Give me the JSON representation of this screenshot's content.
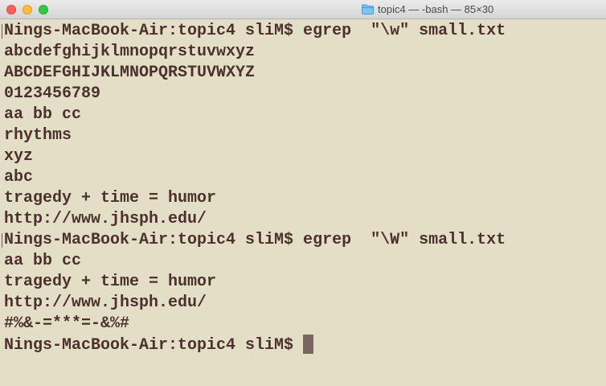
{
  "window": {
    "title": "topic4 — -bash — 85×30",
    "title_icon": "folder-icon",
    "controls": [
      "close-button",
      "minimize-button",
      "zoom-button"
    ],
    "colors": {
      "background": "#e3dfc7",
      "text": "#4b302c",
      "cursor": "#7b655e"
    }
  },
  "terminal": {
    "lines": [
      "Nings-MacBook-Air:topic4 sliM$ egrep  \"\\w\" small.txt",
      "abcdefghijklmnopqrstuvwxyz",
      "ABCDEFGHIJKLMNOPQRSTUVWXYZ",
      "0123456789",
      "aa bb cc",
      "rhythms",
      "xyz",
      "abc",
      "tragedy + time = humor",
      "http://www.jhsph.edu/",
      "Nings-MacBook-Air:topic4 sliM$ egrep  \"\\W\" small.txt",
      "aa bb cc",
      "tragedy + time = humor",
      "http://www.jhsph.edu/",
      "#%&-=***=-&%#"
    ],
    "prompt": "Nings-MacBook-Air:topic4 sliM$ "
  }
}
